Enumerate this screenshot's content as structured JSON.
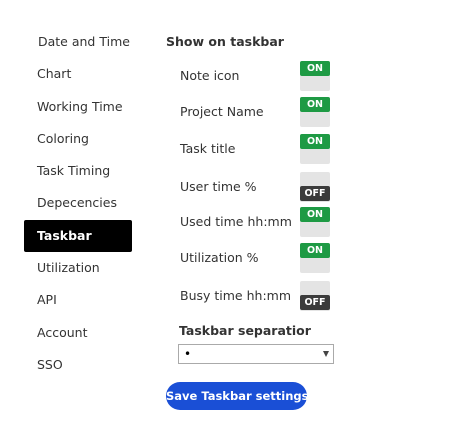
{
  "sidebar": {
    "items": [
      {
        "label": "Date and Time"
      },
      {
        "label": "Chart"
      },
      {
        "label": "Working Time"
      },
      {
        "label": "Coloring"
      },
      {
        "label": "Task Timing"
      },
      {
        "label": "Depecencies"
      },
      {
        "label": "Taskbar",
        "active": true
      },
      {
        "label": "Utilization"
      },
      {
        "label": "API"
      },
      {
        "label": "Account"
      },
      {
        "label": "SSO"
      }
    ]
  },
  "main": {
    "section_title": "Show on taskbar",
    "options": [
      {
        "label": "Note icon",
        "state": "ON"
      },
      {
        "label": "Project Name",
        "state": "ON"
      },
      {
        "label": "Task title",
        "state": "ON"
      },
      {
        "label": "User time %",
        "state": "OFF"
      },
      {
        "label": "Used time hh:mm",
        "state": "ON"
      },
      {
        "label": "Utilization %",
        "state": "ON"
      },
      {
        "label": "Busy time hh:mm",
        "state": "OFF"
      }
    ],
    "separator": {
      "label": "Taskbar separatior",
      "value": "•"
    },
    "save_label": "Save Taskbar settings"
  },
  "colors": {
    "on": "#1e9a44",
    "off": "#3b3b3b",
    "active_nav": "#000000",
    "button": "#1a4fd6"
  },
  "icons": {
    "select_arrow": "chevron-down-icon"
  }
}
